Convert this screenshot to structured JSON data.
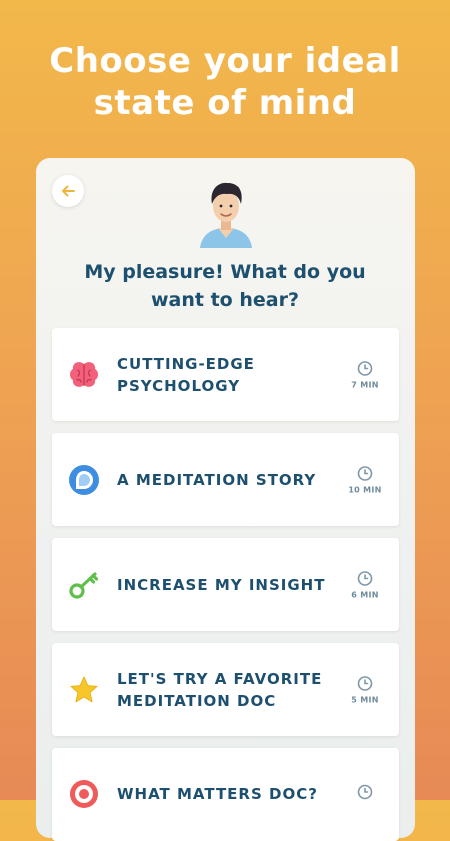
{
  "headline": {
    "line1": "Choose your ideal",
    "line2": "state of mind"
  },
  "panel": {
    "question_line1": "My pleasure! What do you",
    "question_line2": "want to hear?"
  },
  "options": [
    {
      "label_line1": "CUTTING-EDGE",
      "label_line2": "PSYCHOLOGY",
      "duration": "7 MIN",
      "icon": "brain-icon"
    },
    {
      "label_line1": "A MEDITATION STORY",
      "label_line2": "",
      "duration": "10 MIN",
      "icon": "chat-bubble-icon"
    },
    {
      "label_line1": "INCREASE MY INSIGHT",
      "label_line2": "",
      "duration": "6 MIN",
      "icon": "key-icon"
    },
    {
      "label_line1": "LET'S TRY A FAVORITE",
      "label_line2": "MEDITATION DOC",
      "duration": "5 MIN",
      "icon": "star-icon"
    },
    {
      "label_line1": "WHAT MATTERS DOC?",
      "label_line2": "",
      "duration": "",
      "icon": "target-icon"
    }
  ],
  "colors": {
    "accent_text": "#1d4f6e",
    "background_top": "#f2b84a",
    "background_bottom": "#e78a56"
  }
}
